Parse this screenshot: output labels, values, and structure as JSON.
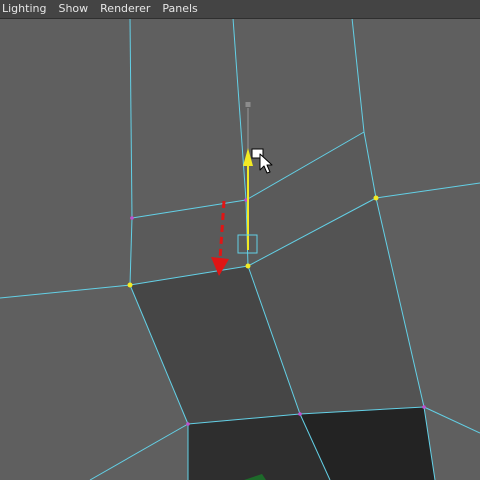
{
  "menubar": {
    "items": [
      {
        "label": "Lighting"
      },
      {
        "label": "Show"
      },
      {
        "label": "Renderer"
      },
      {
        "label": "Panels"
      }
    ]
  },
  "viewport": {
    "background": "#5f5f5f",
    "edge_color": "#63d0e6",
    "selected_vertex_color": "#f2ea24",
    "vertex_color": "#c04fd0",
    "move_arrow_color": "#e01515",
    "manipulator_color": "#f2ea24",
    "faces": [
      "face-upper",
      "face-right",
      "face-selected",
      "face-lower-left",
      "face-lower-right"
    ],
    "icons": [
      "move-manipulator",
      "mouse-cursor-icon",
      "direction-arrow-icon"
    ]
  }
}
